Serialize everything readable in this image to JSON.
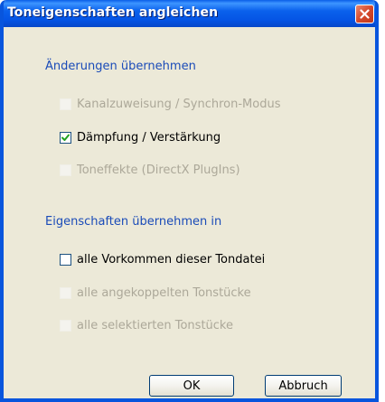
{
  "window": {
    "title": "Toneigenschaften angleichen"
  },
  "group_apply": {
    "label": "Änderungen übernehmen",
    "options": [
      {
        "label": "Kanalzuweisung / Synchron-Modus",
        "checked": false,
        "enabled": false
      },
      {
        "label": "Dämpfung / Verstärkung",
        "checked": true,
        "enabled": true
      },
      {
        "label": "Toneffekte (DirectX PlugIns)",
        "checked": false,
        "enabled": false
      }
    ]
  },
  "group_target": {
    "label": "Eigenschaften übernehmen in",
    "options": [
      {
        "label": "alle Vorkommen dieser Tondatei",
        "checked": false,
        "enabled": true
      },
      {
        "label": "alle angekoppelten Tonstücke",
        "checked": false,
        "enabled": false
      },
      {
        "label": "alle selektierten Tonstücke",
        "checked": false,
        "enabled": false
      }
    ]
  },
  "buttons": {
    "ok_label": "OK",
    "cancel_label": "Abbruch"
  },
  "colors": {
    "titlebar": "#0A5FE8",
    "group_label": "#1A4BB8",
    "disabled_text": "#ACA899",
    "dialog_bg": "#ECE9D8"
  },
  "icons": {
    "close": "close-icon",
    "checkmark": "checkmark-icon"
  }
}
